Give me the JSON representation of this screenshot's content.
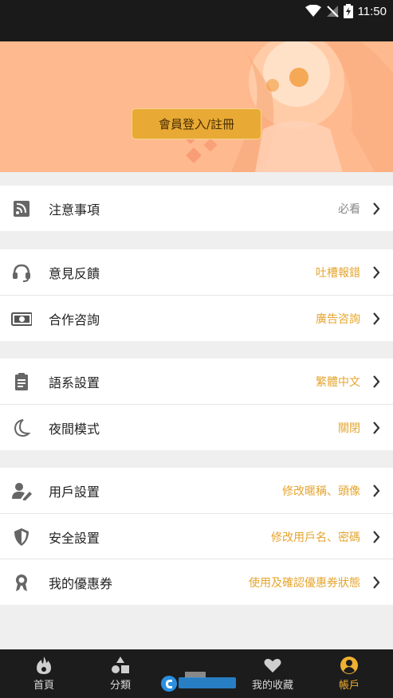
{
  "status_bar": {
    "time": "11:50"
  },
  "header": {
    "login_button": "會員登入/註冊"
  },
  "menu": {
    "notice": {
      "label": "注意事項",
      "value": "必看"
    },
    "feedback": {
      "label": "意見反饋",
      "value": "吐槽報錯"
    },
    "cooperation": {
      "label": "合作咨詢",
      "value": "廣告咨詢"
    },
    "language": {
      "label": "語系設置",
      "value": "繁體中文"
    },
    "night_mode": {
      "label": "夜間模式",
      "value": "關閉"
    },
    "user_settings": {
      "label": "用戶設置",
      "value": "修改暱稱、頭像"
    },
    "security": {
      "label": "安全設置",
      "value": "修改用戶名、密碼"
    },
    "coupons": {
      "label": "我的優惠券",
      "value": "使用及確認優惠券狀態"
    }
  },
  "tabbar": {
    "home": "首頁",
    "category": "分類",
    "favorites": "我的收藏",
    "account": "帳戶"
  },
  "colors": {
    "accent": "#e5a52f",
    "header_bg": "#ffb98f",
    "tabbar_bg": "#1c1c1c"
  }
}
